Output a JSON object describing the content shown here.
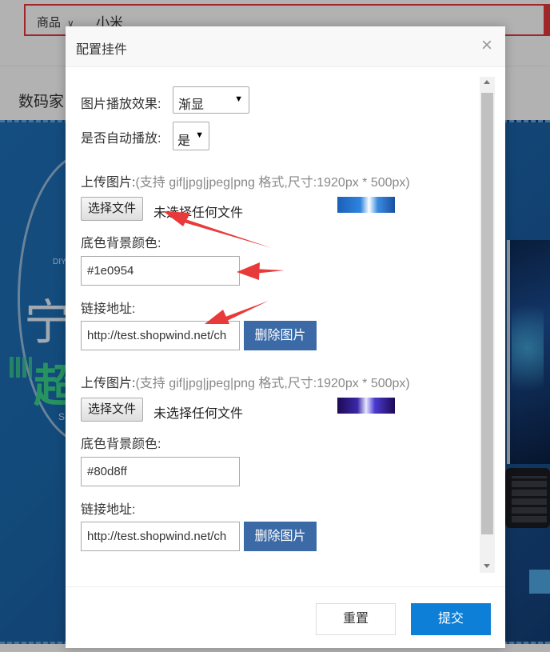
{
  "background": {
    "search_category": "商品",
    "search_query": "小米",
    "floor_title": "数码家"
  },
  "dialog": {
    "title": "配置挂件",
    "close_glyph": "×",
    "effect_label": "图片播放效果:",
    "effect_value": "渐显",
    "autoplay_label": "是否自动播放:",
    "autoplay_value": "是",
    "slides": [
      {
        "upload_label": "上传图片:",
        "upload_hint": "(支持 gif|jpg|jpeg|png 格式,尺寸:1920px * 500px)",
        "choose_file_label": "选择文件",
        "file_status": "未选择任何文件",
        "bgcolor_label": "底色背景颜色:",
        "bgcolor_value": "#1e0954",
        "link_label": "链接地址:",
        "link_value": "http://test.shopwind.net/ch",
        "delete_label": "删除图片"
      },
      {
        "upload_label": "上传图片:",
        "upload_hint": "(支持 gif|jpg|jpeg|png 格式,尺寸:1920px * 500px)",
        "choose_file_label": "选择文件",
        "file_status": "未选择任何文件",
        "bgcolor_label": "底色背景颜色:",
        "bgcolor_value": "#80d8ff",
        "link_label": "链接地址:",
        "link_value": "http://test.shopwind.net/ch",
        "delete_label": "删除图片"
      }
    ],
    "reset_label": "重置",
    "submit_label": "提交"
  },
  "colors": {
    "search_border": "#e4393c",
    "delete_button": "#3b6aa7",
    "submit_button": "#0e7fd6",
    "annotation_arrow": "#e83a3a"
  }
}
